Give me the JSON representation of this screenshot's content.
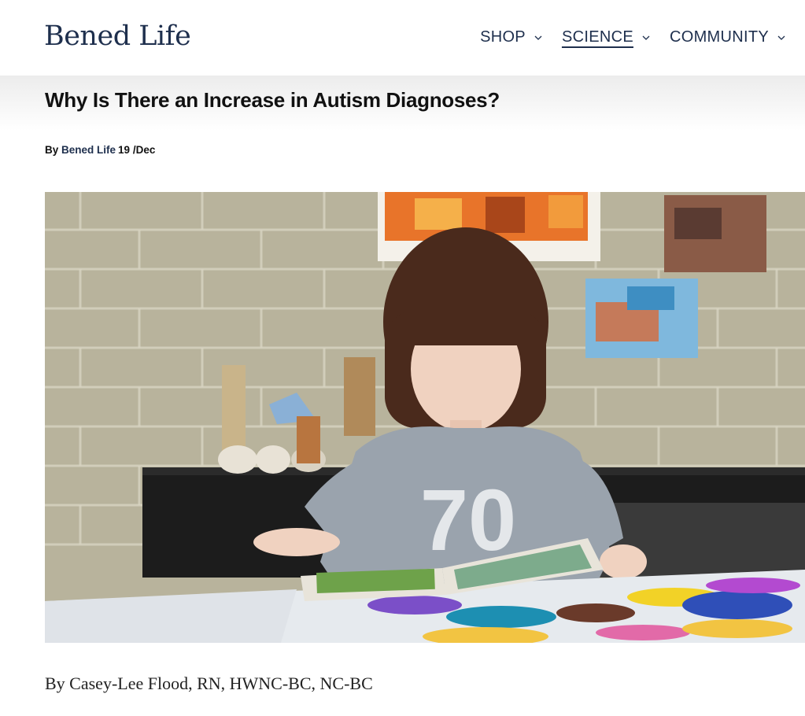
{
  "header": {
    "logo": "Bened Life",
    "nav": [
      {
        "label": "SHOP",
        "icon": "chevron-down-icon"
      },
      {
        "label": "SCIENCE",
        "icon": "chevron-down-icon",
        "active": true
      },
      {
        "label": "COMMUNITY",
        "icon": "chevron-down-icon"
      }
    ]
  },
  "article": {
    "title": "Why Is There an Increase in Autism Diagnoses?",
    "by_prefix": "By",
    "author_link": "Bened Life",
    "date": "19 /Dec",
    "byline": "By Casey-Lee Flood, RN, HWNC-BC, NC-BC",
    "hero_jersey_number": "70"
  },
  "colors": {
    "brand_navy": "#1e2f4d",
    "brick": "#b9b49e"
  }
}
